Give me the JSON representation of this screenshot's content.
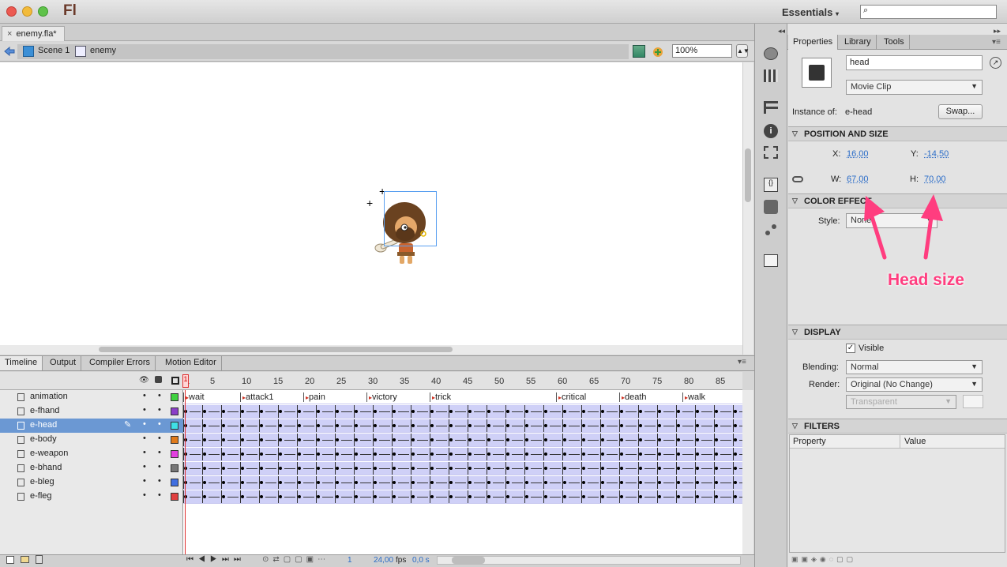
{
  "app": {
    "name": "Fl",
    "workspace": "Essentials"
  },
  "document": {
    "tab": "enemy.fla*"
  },
  "editbar": {
    "scene": "Scene 1",
    "symbol": "enemy",
    "zoom": "100%"
  },
  "timeline": {
    "tabs": [
      "Timeline",
      "Output",
      "Compiler Errors",
      "Motion Editor"
    ],
    "ruler": [
      "1",
      "5",
      "10",
      "15",
      "20",
      "25",
      "30",
      "35",
      "40",
      "45",
      "50",
      "55",
      "60",
      "65",
      "70",
      "75",
      "80",
      "85"
    ],
    "labels": [
      "wait",
      "attack1",
      "pain",
      "victory",
      "trick",
      "critical",
      "death",
      "walk"
    ],
    "layers": [
      "animation",
      "e-fhand",
      "e-head",
      "e-body",
      "e-weapon",
      "e-bhand",
      "e-bleg",
      "e-fleg"
    ],
    "layer_colors": [
      "#3fd13f",
      "#8b3fc8",
      "#3fe0e6",
      "#e07b1c",
      "#e23fe0",
      "#777777",
      "#3f6ee0",
      "#e03f3f"
    ],
    "selected_layer": "e-head",
    "footer": {
      "frame": "1",
      "fps": "24,00",
      "fps_unit": "fps",
      "time": "0,0 s"
    }
  },
  "properties": {
    "tabs": [
      "Properties",
      "Library",
      "Tools"
    ],
    "instance_name": "head",
    "symbol_type": "Movie Clip",
    "instance_of_label": "Instance of:",
    "instance_of": "e-head",
    "swap_label": "Swap...",
    "position_size": {
      "title": "POSITION AND SIZE",
      "x_label": "X:",
      "x": "16,00",
      "y_label": "Y:",
      "y": "-14,50",
      "w_label": "W:",
      "w": "67,00",
      "h_label": "H:",
      "h": "70,00"
    },
    "color_effect": {
      "title": "COLOR EFFECT",
      "style_label": "Style:",
      "style": "None"
    },
    "display": {
      "title": "DISPLAY",
      "visible_label": "Visible",
      "blending_label": "Blending:",
      "blending": "Normal",
      "render_label": "Render:",
      "render": "Original (No Change)",
      "transparent": "Transparent"
    },
    "filters": {
      "title": "FILTERS",
      "col_property": "Property",
      "col_value": "Value"
    }
  },
  "annotation": {
    "text": "Head size",
    "color": "#ff3d7f"
  }
}
